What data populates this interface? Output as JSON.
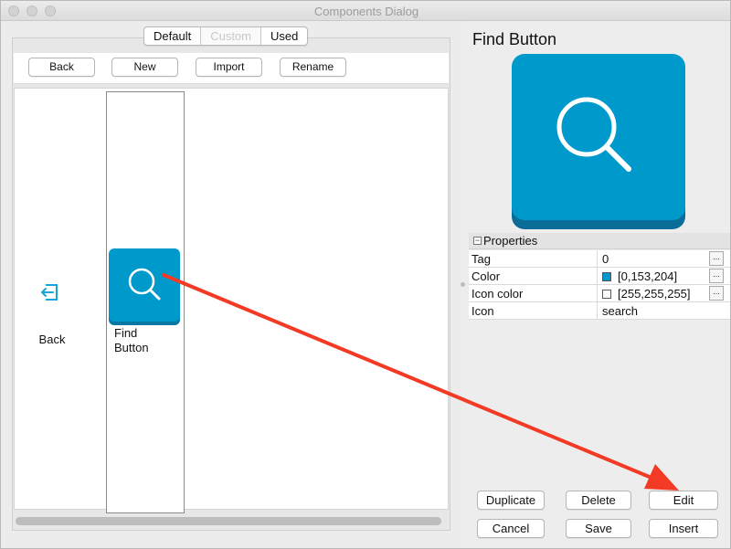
{
  "window": {
    "title": "Components Dialog"
  },
  "tabs": [
    {
      "label": "Default",
      "enabled": true
    },
    {
      "label": "Custom",
      "enabled": false
    },
    {
      "label": "Used",
      "enabled": true
    }
  ],
  "toolbar": {
    "back_label": "Back",
    "new_label": "New",
    "import_label": "Import",
    "rename_label": "Rename"
  },
  "components": [
    {
      "label": "Back",
      "icon": "back-icon"
    },
    {
      "label": "Find\nButton",
      "icon": "search-icon",
      "color": "#0099cc",
      "selected": true
    }
  ],
  "preview": {
    "title": "Find Button",
    "icon": "search-icon",
    "color": "#0099cc"
  },
  "properties": {
    "header": "Properties",
    "rows": [
      {
        "key": "Tag",
        "value": "0",
        "has_button": true
      },
      {
        "key": "Color",
        "value": "[0,153,204]",
        "swatch": "#0099cc",
        "has_button": true
      },
      {
        "key": "Icon color",
        "value": "[255,255,255]",
        "swatch": "#ffffff",
        "has_button": true
      },
      {
        "key": "Icon",
        "value": "search",
        "has_button": false
      }
    ]
  },
  "actions": {
    "duplicate": "Duplicate",
    "delete": "Delete",
    "edit": "Edit",
    "cancel": "Cancel",
    "save": "Save",
    "insert": "Insert"
  },
  "colors": {
    "accent": "#0099cc",
    "annotation": "#f23a24"
  }
}
